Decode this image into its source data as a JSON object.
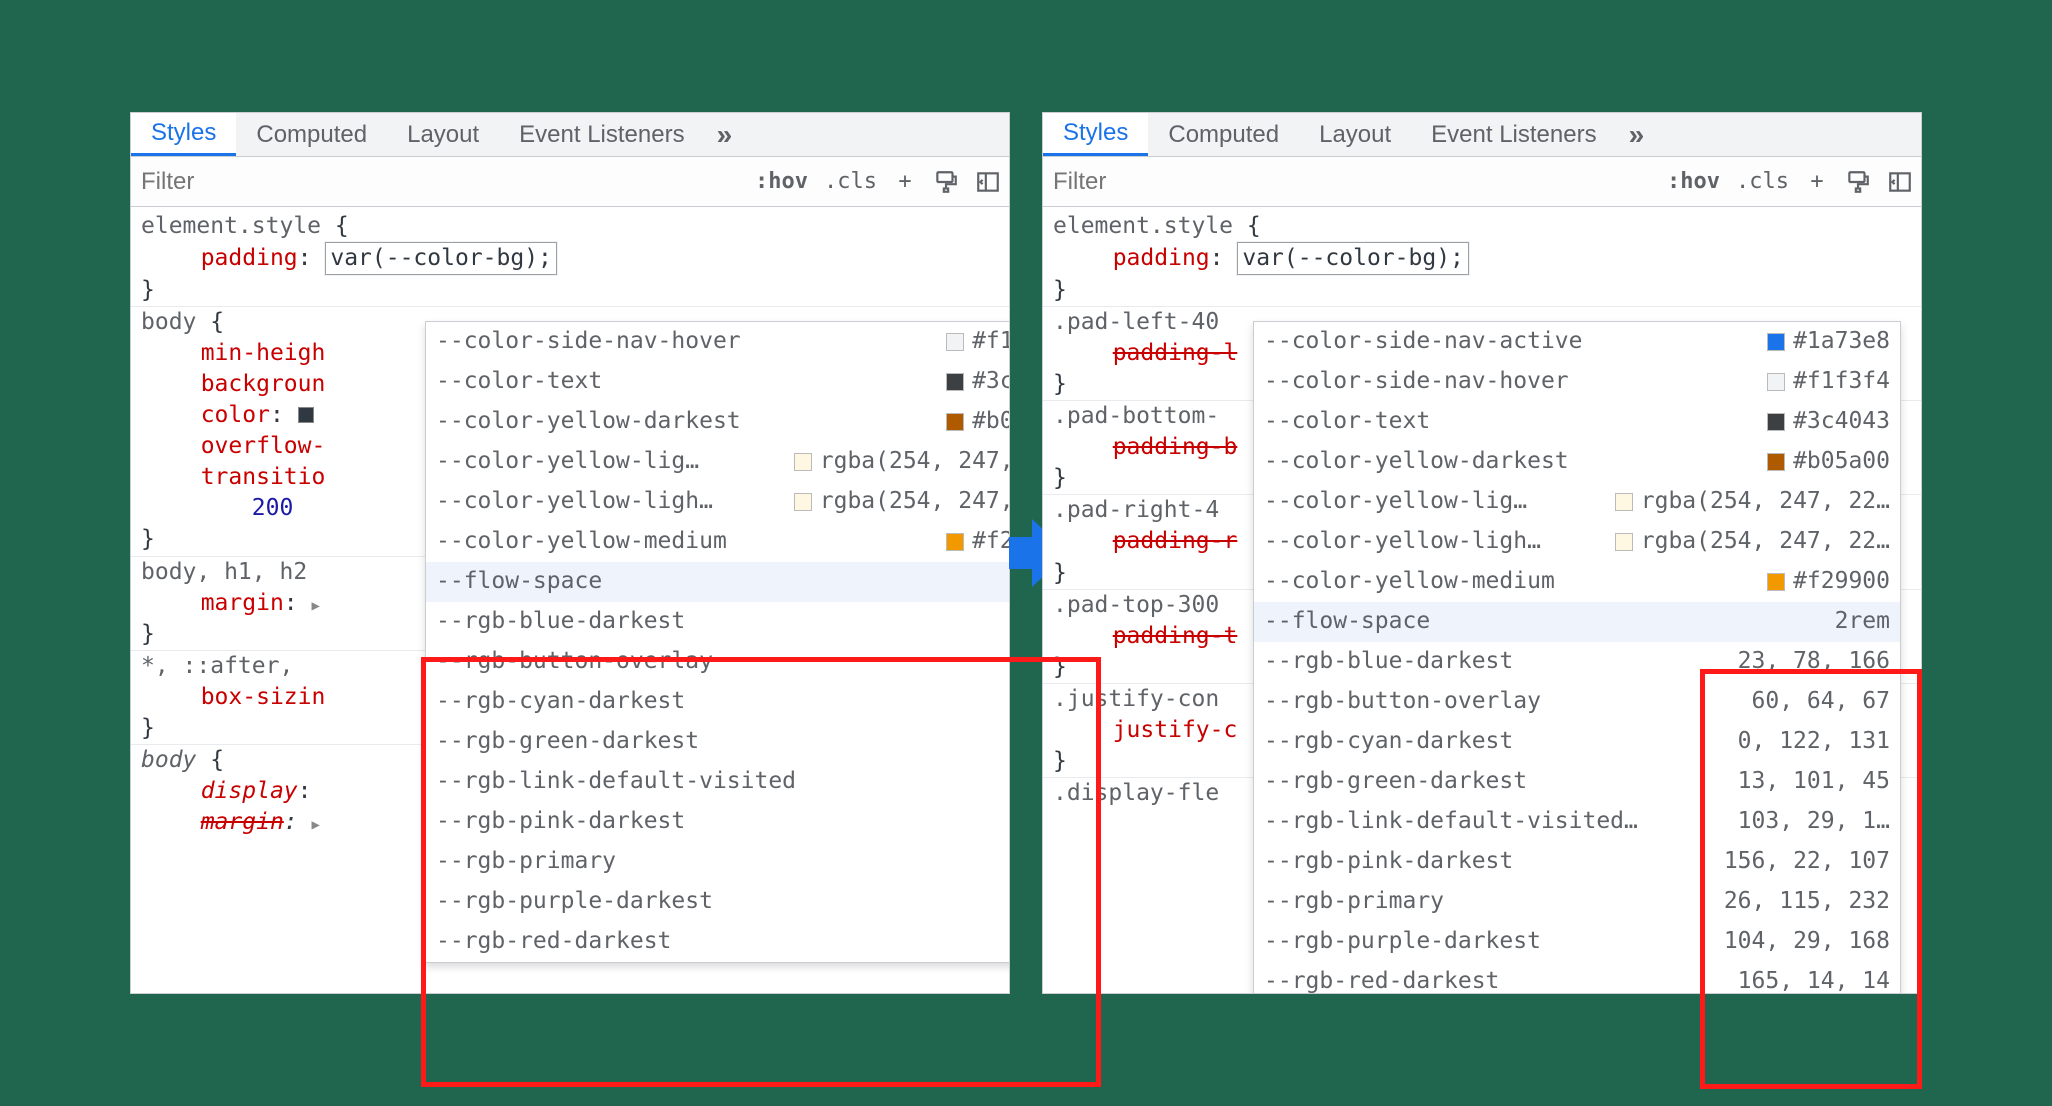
{
  "tabs": {
    "styles": "Styles",
    "computed": "Computed",
    "layout": "Layout",
    "event_listeners": "Event Listeners",
    "more": "»"
  },
  "toolbar": {
    "filter_placeholder": "Filter",
    "hov": ":hov",
    "cls": ".cls",
    "plus": "+"
  },
  "rules_left": {
    "r1_sel": "element.style",
    "r1_prop": "padding",
    "r1_val": "var(--color-bg);",
    "r2_sel": "body",
    "r2_p1": "min-heigh",
    "r2_p2": "backgroun",
    "r2_p3": "color",
    "r2_p4": "overflow-",
    "r2_p5": "transitio",
    "r2_p5b": "200",
    "r3_sel": "body, h1, h2",
    "r3_p1": "margin",
    "r4_sel": "*, ::after,",
    "r4_p1": "box-sizin",
    "r5_sel": "body",
    "r5_p1": "display",
    "r5_p2": "margin"
  },
  "rules_right": {
    "r1_sel": "element.style",
    "r1_prop": "padding",
    "r1_val": "var(--color-bg);",
    "r2_sel": ".pad-left-40",
    "r2_p1": "padding-l",
    "r3_sel": ".pad-bottom-",
    "r3_p1": "padding-b",
    "r4_sel": ".pad-right-4",
    "r4_p1": "padding-r",
    "r5_sel": ".pad-top-300",
    "r5_p1": "padding-t",
    "r6_sel": ".justify-con",
    "r6_p1": "justify-c",
    "r7_sel": ".display-fle"
  },
  "dropdown": [
    {
      "label": "--color-side-nav-active",
      "swatch": "#1a73e8",
      "value": "#1a73e8",
      "hidden_left": true
    },
    {
      "label": "--color-side-nav-hover",
      "swatch": "#f1f3f4",
      "value": "#f1f3f4"
    },
    {
      "label": "--color-text",
      "swatch": "#3c4043",
      "value": "#3c4043"
    },
    {
      "label": "--color-yellow-darkest",
      "swatch": "#b05a00",
      "value": "#b05a00"
    },
    {
      "label": "--color-yellow-lig…",
      "swatch": "rgba(254,247,225,1)",
      "value": "rgba(254, 247, 22…"
    },
    {
      "label": "--color-yellow-ligh…",
      "swatch": "rgba(254,247,225,1)",
      "value": "rgba(254, 247, 22…"
    },
    {
      "label": "--color-yellow-medium",
      "swatch": "#f29900",
      "value": "#f29900"
    },
    {
      "label": "--flow-space",
      "value_right": "2rem",
      "highlight": true
    },
    {
      "label": "--rgb-blue-darkest",
      "value_right": "23, 78, 166"
    },
    {
      "label": "--rgb-button-overlay",
      "value_right": "60, 64, 67"
    },
    {
      "label": "--rgb-cyan-darkest",
      "value_right": "0, 122, 131"
    },
    {
      "label": "--rgb-green-darkest",
      "value_right": "13, 101, 45"
    },
    {
      "label": "--rgb-link-default-visited",
      "label_right": "--rgb-link-default-visited…",
      "value_right": "103, 29, 1…"
    },
    {
      "label": "--rgb-pink-darkest",
      "value_right": "156, 22, 107"
    },
    {
      "label": "--rgb-primary",
      "value_right": "26, 115, 232"
    },
    {
      "label": "--rgb-purple-darkest",
      "value_right": "104, 29, 168"
    },
    {
      "label": "--rgb-red-darkest",
      "value_right": "165, 14, 14"
    }
  ]
}
